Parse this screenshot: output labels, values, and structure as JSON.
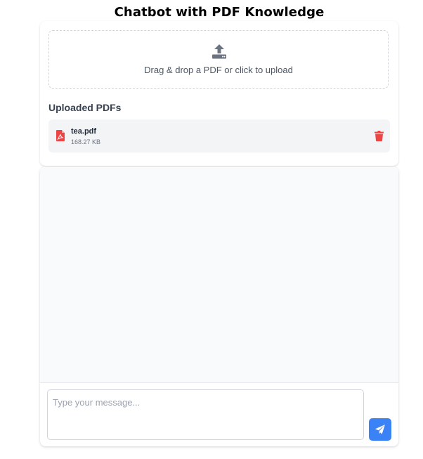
{
  "header": {
    "title": "Chatbot with PDF Knowledge"
  },
  "upload": {
    "dropzone_text": "Drag & drop a PDF or click to upload",
    "icon": "upload-icon",
    "section_title": "Uploaded PDFs",
    "files": [
      {
        "name": "tea.pdf",
        "size": "168.27 KB",
        "icon": "pdf-file-icon",
        "delete_icon": "trash-icon"
      }
    ]
  },
  "chat": {
    "input_placeholder": "Type your message...",
    "input_value": "",
    "send_icon": "paper-plane-icon"
  },
  "colors": {
    "accent": "#3b82f6",
    "danger": "#ef4444",
    "icon_gray": "#6b7280",
    "chat_background": "#f9fafb",
    "file_item_background": "#f3f4f6"
  }
}
